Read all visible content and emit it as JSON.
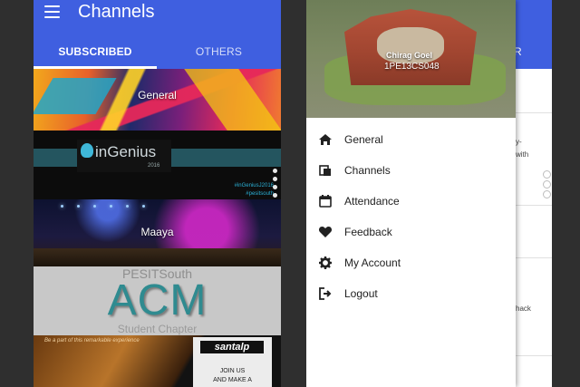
{
  "left_screen": {
    "app_title": "Channels",
    "tabs": [
      {
        "label": "SUBSCRIBED",
        "active": true
      },
      {
        "label": "OTHERS",
        "active": false
      }
    ],
    "channels": [
      {
        "label": "General"
      },
      {
        "logo_text": "inGenius",
        "year": "2016",
        "tags": [
          "#inGeniusJ2016",
          "#pesitsouth"
        ]
      },
      {
        "label": "Maaya"
      },
      {
        "top_text": "PESITSouth",
        "logo_text": "ACM",
        "bottom_text": "Student Chapter"
      },
      {
        "tagline": "Be a part of this remarkable experience",
        "logo_text": "santalp",
        "join_text": "JOIN US",
        "make_text": "AND MAKE A"
      }
    ]
  },
  "right_screen": {
    "profile": {
      "name": "Chirag Goel",
      "id": "1PE13CS048"
    },
    "menu": [
      {
        "label": "General",
        "icon": "home-icon"
      },
      {
        "label": "Channels",
        "icon": "channels-icon"
      },
      {
        "label": "Attendance",
        "icon": "calendar-icon"
      },
      {
        "label": "Feedback",
        "icon": "heart-icon"
      },
      {
        "label": "My Account",
        "icon": "gear-icon"
      },
      {
        "label": "Logout",
        "icon": "logout-icon"
      }
    ],
    "behind_tab_fragment": "R",
    "behind_text": [
      "y-",
      "with",
      "hack"
    ]
  },
  "colors": {
    "primary": "#3f5fe0",
    "background": "#2f2f2f",
    "drawer_bg": "#ffffff",
    "text_dark": "#212121"
  }
}
